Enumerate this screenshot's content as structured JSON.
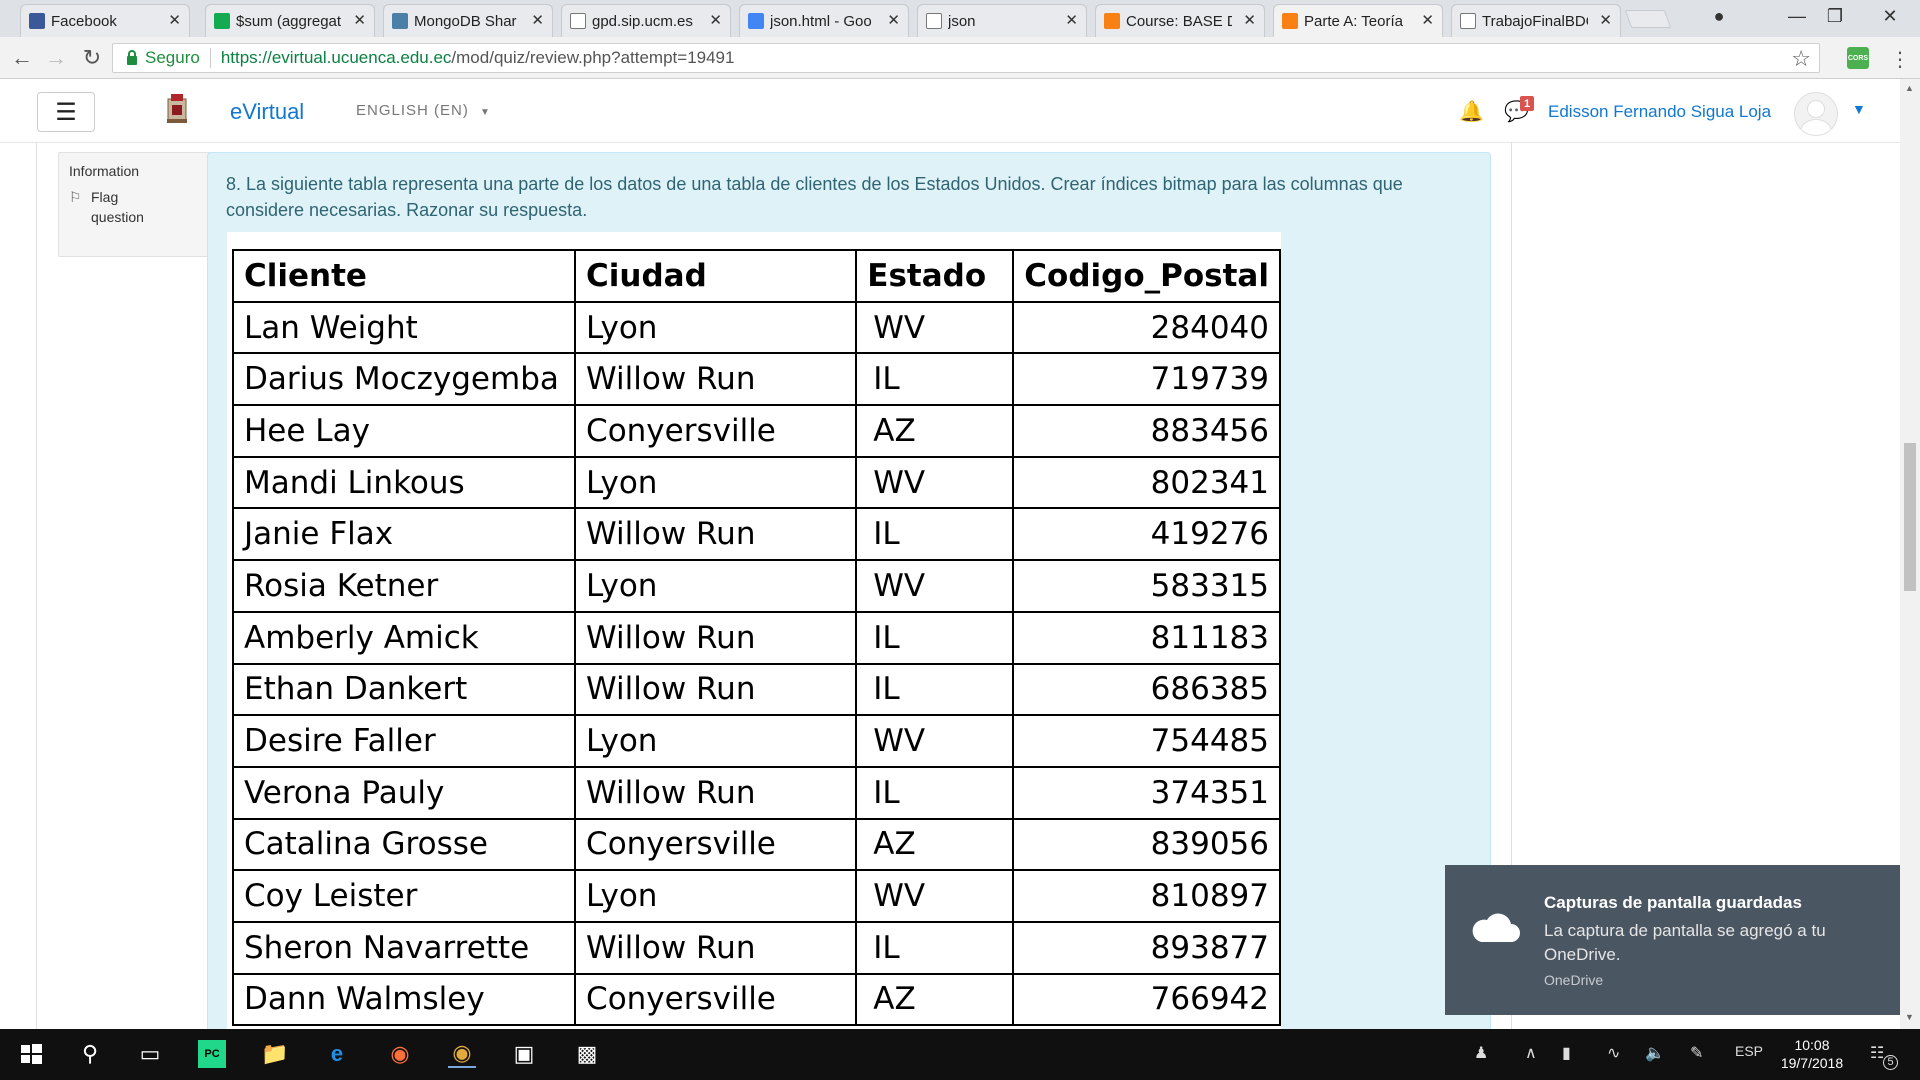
{
  "browser": {
    "tabs": [
      {
        "label": "Facebook",
        "icon": "facebook-icon"
      },
      {
        "label": "$sum (aggregat",
        "icon": "leaf-icon"
      },
      {
        "label": "MongoDB Shar",
        "icon": "wave-icon"
      },
      {
        "label": "gpd.sip.ucm.es",
        "icon": "page-icon"
      },
      {
        "label": "json.html - Goo",
        "icon": "doc-icon"
      },
      {
        "label": "json",
        "icon": "page-icon"
      },
      {
        "label": "Course: BASE D",
        "icon": "moodle-icon"
      },
      {
        "label": "Parte A: Teoría",
        "icon": "moodle-icon"
      },
      {
        "label": "TrabajoFinalBDC",
        "icon": "page-icon"
      }
    ],
    "secure_label": "Seguro",
    "url_base": "https://evirtual.ucuenca.edu.ec",
    "url_path": "/mod/quiz/review.php?attempt=19491",
    "extension_label": "CORS"
  },
  "navbar": {
    "site_name": "eVirtual",
    "language": "ENGLISH (EN)",
    "message_count": "1",
    "user_name": "Edisson Fernando Sigua Loja"
  },
  "info_block": {
    "title": "Information",
    "flag_label": "Flag question"
  },
  "question": {
    "text": "8. La siguiente tabla representa una parte de los datos de una tabla de clientes de los Estados Unidos. Crear índices bitmap para las columnas que considere necesarias. Razonar su respuesta.",
    "table": {
      "headers": [
        "Cliente",
        "Ciudad",
        "Estado",
        "Codigo_Postal"
      ],
      "rows": [
        [
          "Lan Weight",
          "Lyon",
          "WV",
          "284040"
        ],
        [
          "Darius Moczygemba",
          "Willow Run",
          "IL",
          "719739"
        ],
        [
          "Hee Lay",
          "Conyersville",
          "AZ",
          "883456"
        ],
        [
          "Mandi Linkous",
          "Lyon",
          "WV",
          "802341"
        ],
        [
          "Janie Flax",
          "Willow Run",
          "IL",
          "419276"
        ],
        [
          "Rosia Ketner",
          "Lyon",
          "WV",
          "583315"
        ],
        [
          "Amberly Amick",
          "Willow Run",
          "IL",
          "811183"
        ],
        [
          "Ethan Dankert",
          "Willow Run",
          "IL",
          "686385"
        ],
        [
          "Desire Faller",
          "Lyon",
          "WV",
          "754485"
        ],
        [
          "Verona Pauly",
          "Willow Run",
          "IL",
          "374351"
        ],
        [
          "Catalina Grosse",
          "Conyersville",
          "AZ",
          "839056"
        ],
        [
          "Coy Leister",
          "Lyon",
          "WV",
          "810897"
        ],
        [
          "Sheron Navarrette",
          "Willow Run",
          "IL",
          "893877"
        ],
        [
          "Dann Walmsley",
          "Conyersville",
          "AZ",
          "766942"
        ]
      ]
    }
  },
  "toast": {
    "title": "Capturas de pantalla guardadas",
    "body": "La captura de pantalla se agregó a tu OneDrive.",
    "source": "OneDrive"
  },
  "taskbar": {
    "language": "ESP",
    "time": "10:08",
    "date": "19/7/2018",
    "notification_count": "5"
  },
  "colors": {
    "accent": "#1177d1",
    "question_bg": "#def2f8",
    "question_text": "#2f6473",
    "toast_bg": "#4b5663",
    "taskbar_bg": "#101010"
  }
}
